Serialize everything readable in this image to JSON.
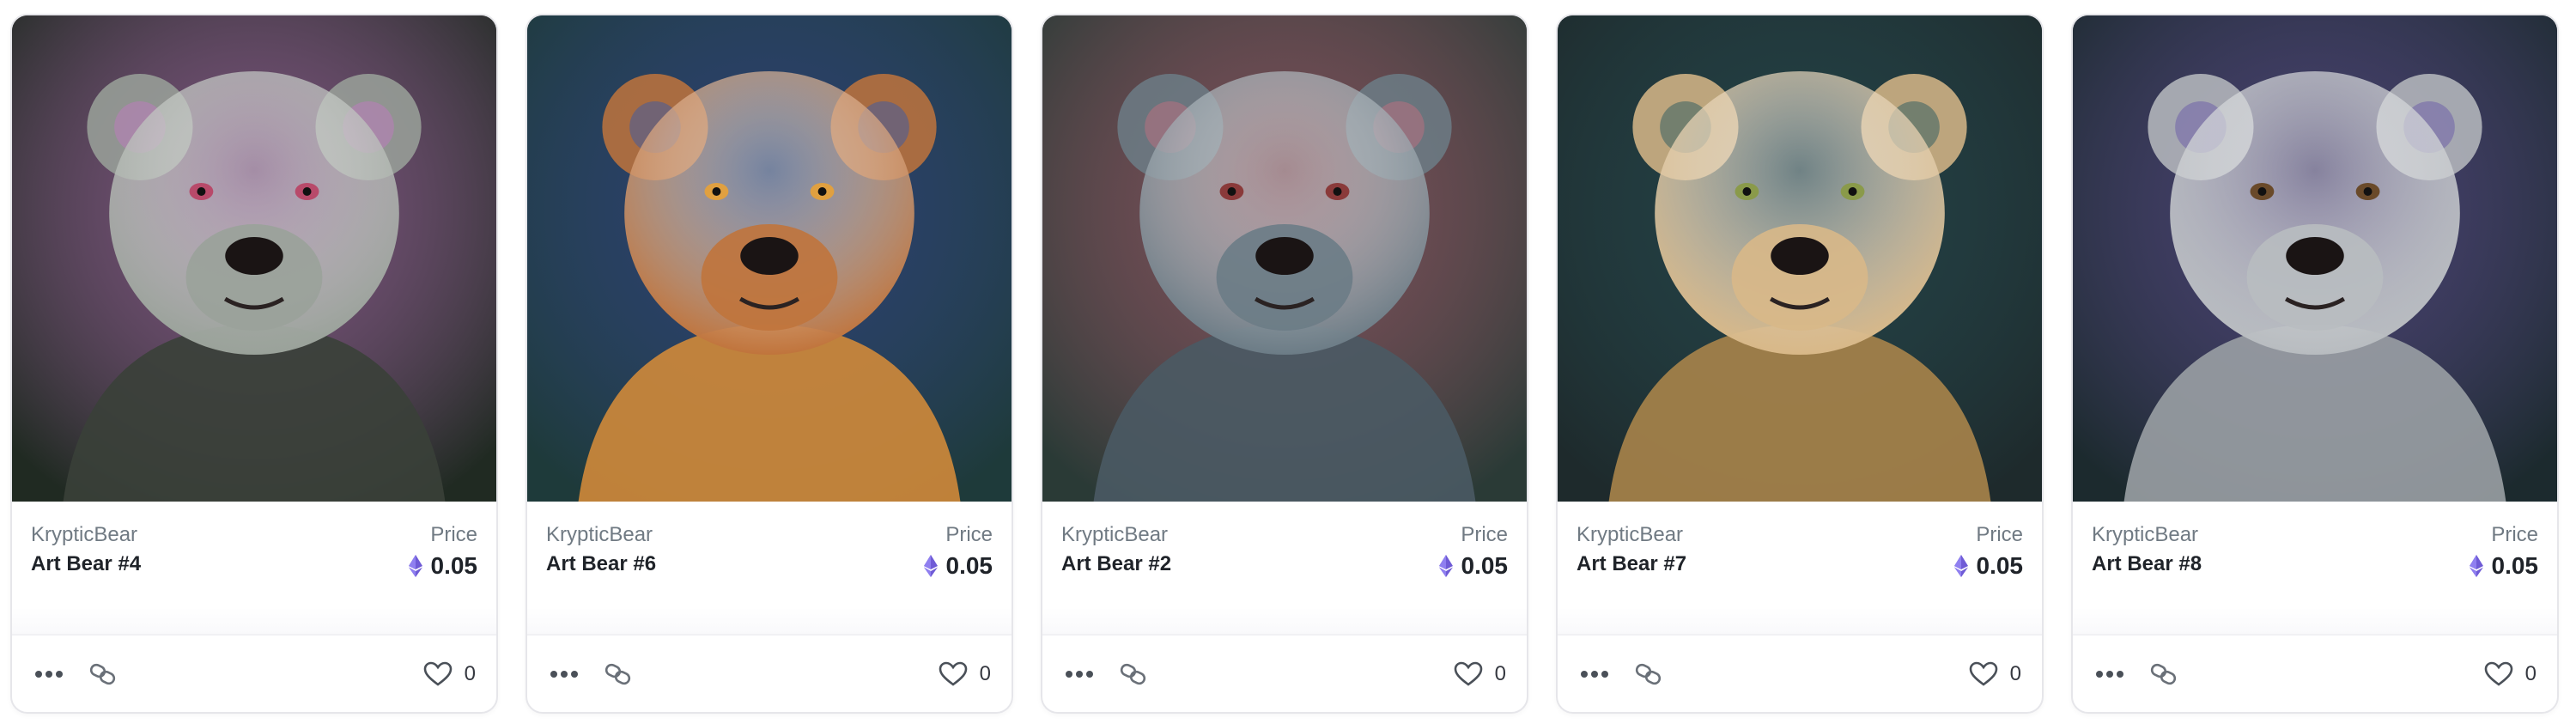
{
  "cards": [
    {
      "collection": "KrypticBear",
      "name": "Art Bear #4",
      "price_label": "Price",
      "price": "0.05",
      "likes": "0",
      "palette": {
        "bg": "#202a22",
        "fur": "#9aa29a",
        "accent": "#c07ac0",
        "eye": "#b84a6a",
        "body": "#3a4038"
      }
    },
    {
      "collection": "KrypticBear",
      "name": "Art Bear #6",
      "price_label": "Price",
      "price": "0.05",
      "likes": "0",
      "palette": {
        "bg": "#1e3a3a",
        "fur": "#c0743c",
        "accent": "#3a5aa8",
        "eye": "#e0a040",
        "body": "#d08a3a"
      }
    },
    {
      "collection": "KrypticBear",
      "name": "Art Bear #2",
      "price_label": "Price",
      "price": "0.05",
      "likes": "0",
      "palette": {
        "bg": "#2a3a36",
        "fur": "#6c7c86",
        "accent": "#c07080",
        "eye": "#8a3a3a",
        "body": "#4a5a64"
      }
    },
    {
      "collection": "KrypticBear",
      "name": "Art Bear #7",
      "price_label": "Price",
      "price": "0.05",
      "likes": "0",
      "palette": {
        "bg": "#1e2a2c",
        "fur": "#d8b888",
        "accent": "#2a5a60",
        "eye": "#8a9a4a",
        "body": "#a8844a"
      }
    },
    {
      "collection": "KrypticBear",
      "name": "Art Bear #8",
      "price_label": "Price",
      "price": "0.05",
      "likes": "0",
      "palette": {
        "bg": "#1c2a2e",
        "fur": "#b8bcc0",
        "accent": "#6a5aa8",
        "eye": "#6a4a2a",
        "body": "#9aa0a4"
      }
    }
  ],
  "colors": {
    "eth": "#6f5bd6",
    "muted": "#707a83",
    "text": "#1f2329"
  }
}
